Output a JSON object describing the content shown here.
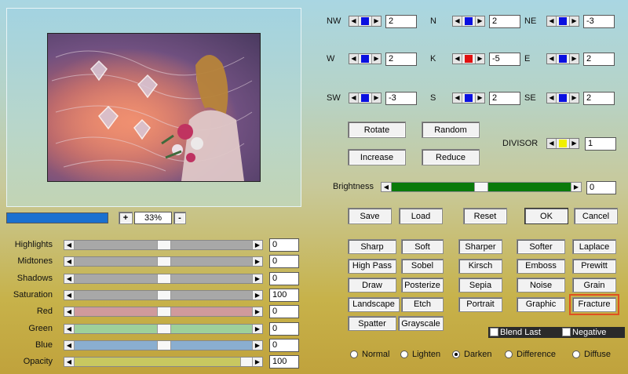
{
  "preview": {
    "zoom_plus": "+",
    "zoom_value": "33%",
    "zoom_minus": "-"
  },
  "matrix": [
    {
      "key": "NW",
      "label": "NW",
      "value": "2",
      "knob_color": "#0a10e0"
    },
    {
      "key": "N",
      "label": "N",
      "value": "2",
      "knob_color": "#0a10e0"
    },
    {
      "key": "NE",
      "label": "NE",
      "value": "-3",
      "knob_color": "#0a10e0"
    },
    {
      "key": "W",
      "label": "W",
      "value": "2",
      "knob_color": "#0a10e0"
    },
    {
      "key": "K",
      "label": "K",
      "value": "-5",
      "knob_color": "#e01010"
    },
    {
      "key": "E",
      "label": "E",
      "value": "2",
      "knob_color": "#0a10e0"
    },
    {
      "key": "SW",
      "label": "SW",
      "value": "-3",
      "knob_color": "#0a10e0"
    },
    {
      "key": "S",
      "label": "S",
      "value": "2",
      "knob_color": "#0a10e0"
    },
    {
      "key": "SE",
      "label": "SE",
      "value": "2",
      "knob_color": "#0a10e0"
    }
  ],
  "divisor": {
    "label": "DIVISOR",
    "value": "1",
    "knob_color": "#f0f000"
  },
  "transform_buttons": {
    "rotate": "Rotate",
    "random": "Random",
    "increase": "Increase",
    "reduce": "Reduce"
  },
  "brightness": {
    "label": "Brightness",
    "value": "0",
    "fill_color": "#0a7a0a"
  },
  "file_buttons": {
    "save": "Save",
    "load": "Load",
    "reset": "Reset",
    "ok": "OK",
    "cancel": "Cancel"
  },
  "adjustments": [
    {
      "label": "Highlights",
      "value": "0",
      "track_color": "#a8a8a8",
      "level": 0.5
    },
    {
      "label": "Midtones",
      "value": "0",
      "track_color": "#a8a8a8",
      "level": 0.5
    },
    {
      "label": "Shadows",
      "value": "0",
      "track_color": "#a8a8a8",
      "level": 0.5
    },
    {
      "label": "Saturation",
      "value": "100",
      "track_color": "#a8a8a8",
      "level": 0.5
    },
    {
      "label": "Red",
      "value": "0",
      "track_color": "#d09a9c",
      "level": 0.5
    },
    {
      "label": "Green",
      "value": "0",
      "track_color": "#9ed09a",
      "level": 0.5
    },
    {
      "label": "Blue",
      "value": "0",
      "track_color": "#8aaed0",
      "level": 0.5
    },
    {
      "label": "Opacity",
      "value": "100",
      "track_color": "#c8c860",
      "level": 1.0
    }
  ],
  "presets": [
    [
      "Sharp",
      "Soft",
      "Sharper",
      "Softer",
      "Laplace"
    ],
    [
      "High Pass",
      "Sobel",
      "Kirsch",
      "Emboss",
      "Prewitt"
    ],
    [
      "Draw",
      "Posterize",
      "Sepia",
      "Noise",
      "Grain"
    ],
    [
      "Landscape",
      "Etch",
      "Portrait",
      "Graphic",
      "Fracture"
    ],
    [
      "Spatter",
      "Grayscale"
    ]
  ],
  "selected_preset": "Fracture",
  "highlight_color": "#e05020",
  "options": {
    "blend_last": "Blend Last",
    "negative": "Negative"
  },
  "blend_modes": {
    "normal": "Normal",
    "lighten": "Lighten",
    "darken": "Darken",
    "difference": "Difference",
    "diffuse": "Diffuse",
    "selected": "Darken"
  },
  "progress_color": "#1a70d0"
}
